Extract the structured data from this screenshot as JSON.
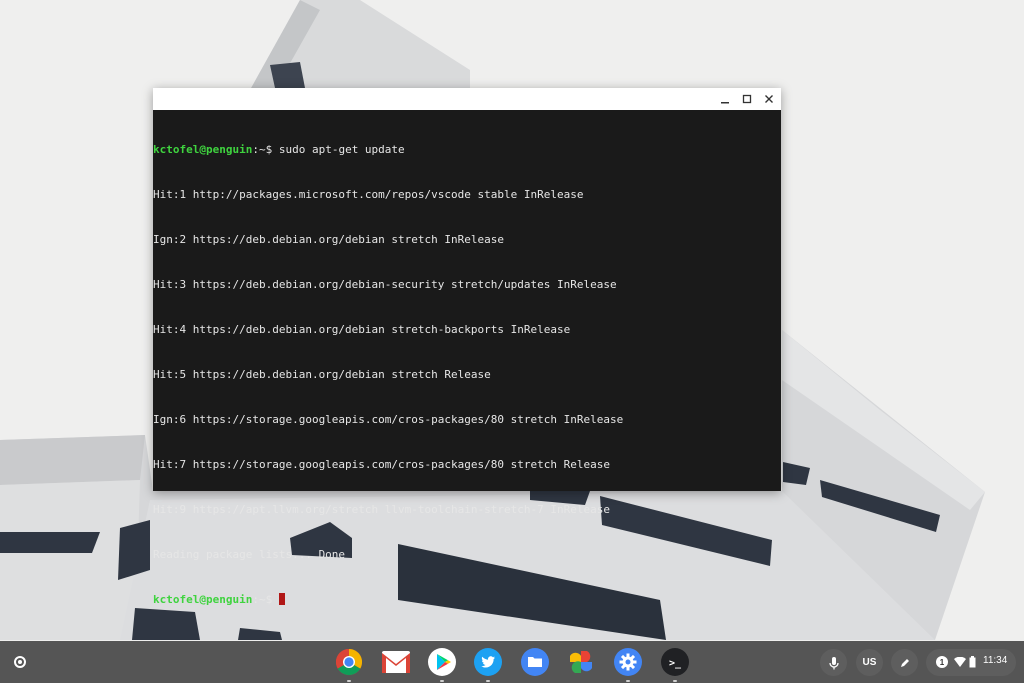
{
  "window": {
    "buttons": {
      "minimize": "minimize-icon",
      "maximize": "maximize-icon",
      "close": "close-icon"
    }
  },
  "terminal": {
    "user_host": "kctofel@penguin",
    "path_suffix": ":~$",
    "command": " sudo apt-get update",
    "output": [
      "Hit:1 http://packages.microsoft.com/repos/vscode stable InRelease",
      "Ign:2 https://deb.debian.org/debian stretch InRelease",
      "Hit:3 https://deb.debian.org/debian-security stretch/updates InRelease",
      "Hit:4 https://deb.debian.org/debian stretch-backports InRelease",
      "Hit:5 https://deb.debian.org/debian stretch Release",
      "Ign:6 https://storage.googleapis.com/cros-packages/80 stretch InRelease",
      "Hit:7 https://storage.googleapis.com/cros-packages/80 stretch Release",
      "Hit:9 https://apt.llvm.org/stretch llvm-toolchain-stretch-7 InRelease",
      "Reading package lists... Done"
    ],
    "final_prompt_user": "kctofel@penguin",
    "final_prompt_suffix": ":~$"
  },
  "shelf": {
    "apps": [
      "chrome-icon",
      "gmail-icon",
      "play-store-icon",
      "twitter-icon",
      "files-icon",
      "photos-icon",
      "settings-icon",
      "terminal-icon"
    ],
    "terminal_glyph": ">_",
    "ime": "US",
    "notification_count": "1",
    "time": "11:34"
  },
  "colors": {
    "terminal_bg": "#1a1a1a",
    "prompt_green": "#3fd33f",
    "cursor_red": "#b01616",
    "shelf_bg": "#404040"
  }
}
